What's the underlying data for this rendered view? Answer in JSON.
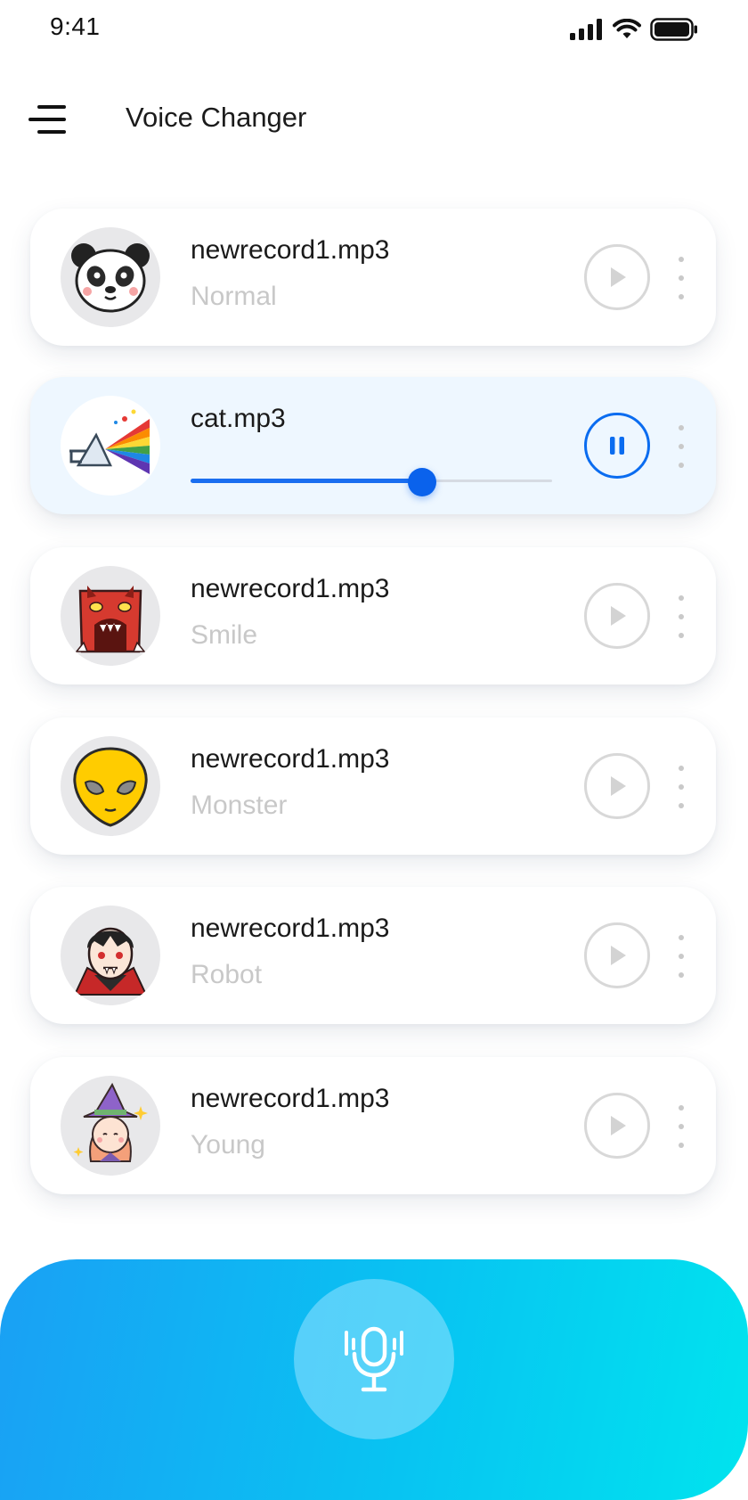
{
  "status_bar": {
    "time": "9:41"
  },
  "header": {
    "title": "Voice Changer",
    "menu_icon": "hamburger-menu-icon"
  },
  "recordings": [
    {
      "file": "newrecord1.mp3",
      "effect": "Normal",
      "avatar": "panda-icon",
      "state": "stopped"
    },
    {
      "file": "cat.mp3",
      "effect": "",
      "avatar": "prism-rainbow-icon",
      "state": "playing",
      "progress": 0.64
    },
    {
      "file": "newrecord1.mp3",
      "effect": "Smile",
      "avatar": "red-monster-icon",
      "state": "stopped"
    },
    {
      "file": "newrecord1.mp3",
      "effect": "Monster",
      "avatar": "alien-icon",
      "state": "stopped"
    },
    {
      "file": "newrecord1.mp3",
      "effect": "Robot",
      "avatar": "vampire-icon",
      "state": "stopped"
    },
    {
      "file": "newrecord1.mp3",
      "effect": "Young",
      "avatar": "witch-girl-icon",
      "state": "stopped"
    }
  ],
  "record_button": {
    "icon": "microphone-icon"
  },
  "colors": {
    "accent": "#0a6cf0",
    "active_row_bg": "#eef7ff",
    "gradient_start": "#1aa0f4",
    "gradient_end": "#00e4ee",
    "subtitle": "#c8c8c8"
  }
}
